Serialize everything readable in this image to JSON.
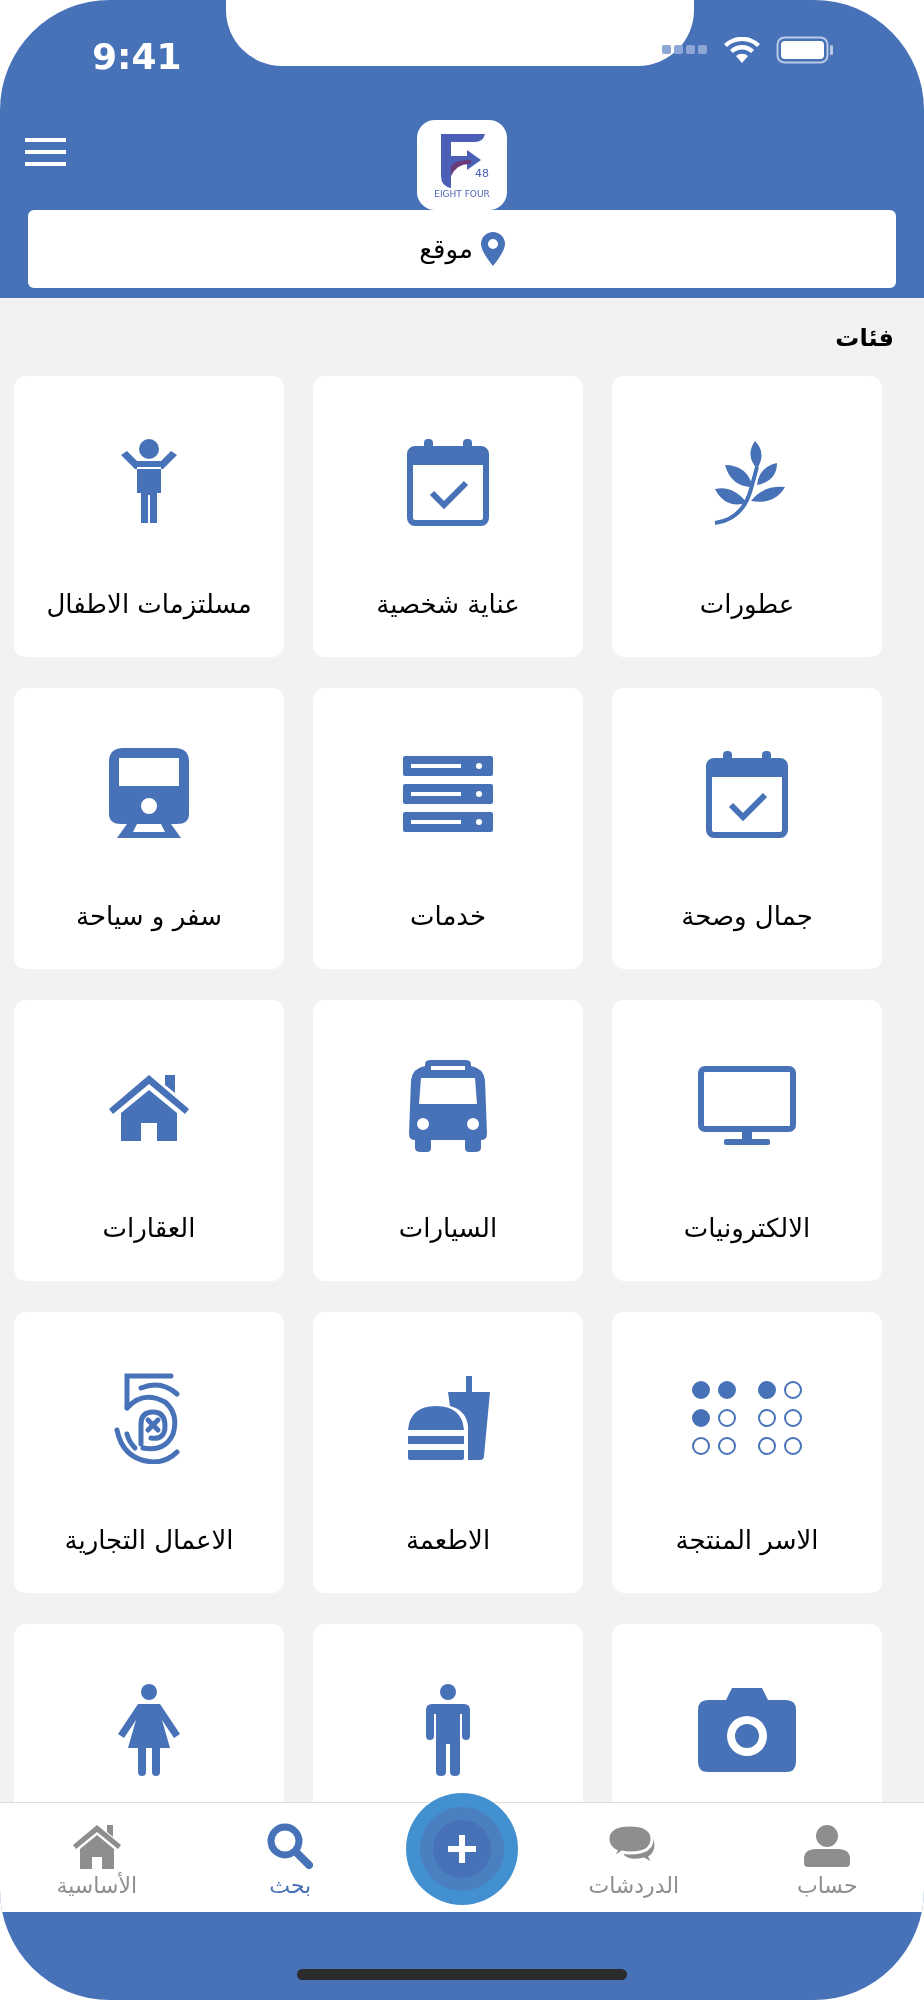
{
  "status_bar": {
    "time": "9:41"
  },
  "header": {
    "logo": {
      "number": "48",
      "caption": "EIGHT FOUR"
    },
    "location": {
      "label": "موقع"
    }
  },
  "section_title": "فئات",
  "categories": [
    {
      "kind": "full",
      "label": "عطورات"
    },
    {
      "kind": "full",
      "label": "عناية شخصية"
    },
    {
      "kind": "full",
      "label": "مسلتزمات الاطفال"
    },
    {
      "kind": "full",
      "label": "جمال وصحة"
    },
    {
      "kind": "full",
      "label": "خدمات"
    },
    {
      "kind": "full",
      "label": "سفر و سياحة"
    },
    {
      "kind": "full",
      "label": "الالكترونيات"
    },
    {
      "kind": "full",
      "label": "السيارات"
    },
    {
      "kind": "full",
      "label": "العقارات"
    },
    {
      "kind": "full",
      "label": "الاسر المنتجة"
    },
    {
      "kind": "full",
      "label": "الاطعمة"
    },
    {
      "kind": "full",
      "label": "الاعمال التجارية"
    },
    {
      "kind": "cut"
    },
    {
      "kind": "cut"
    },
    {
      "kind": "cut"
    }
  ],
  "bottom_nav": [
    {
      "kind": "tab",
      "label": "حساب",
      "selected": false
    },
    {
      "kind": "tab",
      "label": "الدردشات",
      "selected": false
    },
    {
      "kind": "add"
    },
    {
      "kind": "tab",
      "label": "بحث",
      "selected": true
    },
    {
      "kind": "tab",
      "label": "الأساسية",
      "selected": false
    }
  ]
}
